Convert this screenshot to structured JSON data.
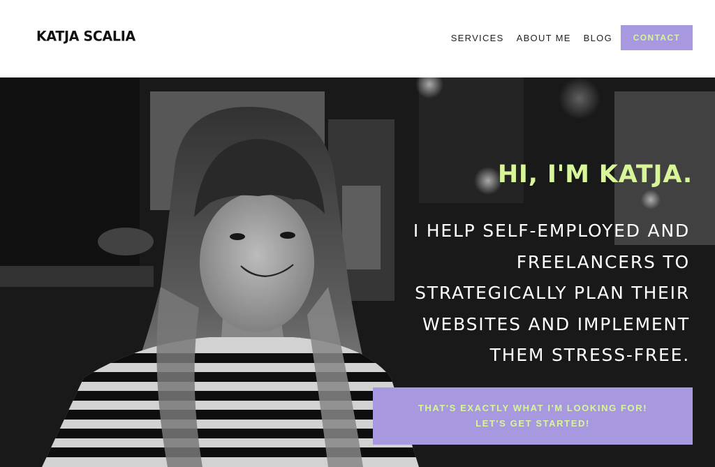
{
  "site": {
    "logo": "KATJA SCALIA"
  },
  "nav": {
    "items": [
      {
        "label": "SERVICES"
      },
      {
        "label": "ABOUT ME"
      },
      {
        "label": "BLOG"
      }
    ],
    "contact_label": "CONTACT"
  },
  "hero": {
    "greeting": "HI, I'M KATJA.",
    "lines": [
      "I HELP SELF-EMPLOYED AND",
      "FREELANCERS TO",
      "STRATEGICALLY PLAN THEIR",
      "WEBSITES AND IMPLEMENT",
      "THEM STRESS-FREE."
    ],
    "cta_lines": [
      "THAT'S EXACTLY WHAT I'M LOOKING FOR!",
      "LET'S GET STARTED!"
    ]
  },
  "colors": {
    "accent_purple": "#a898e0",
    "accent_lime": "#d8f59a",
    "header_bg": "#ffffff",
    "text_dark": "#222222"
  }
}
